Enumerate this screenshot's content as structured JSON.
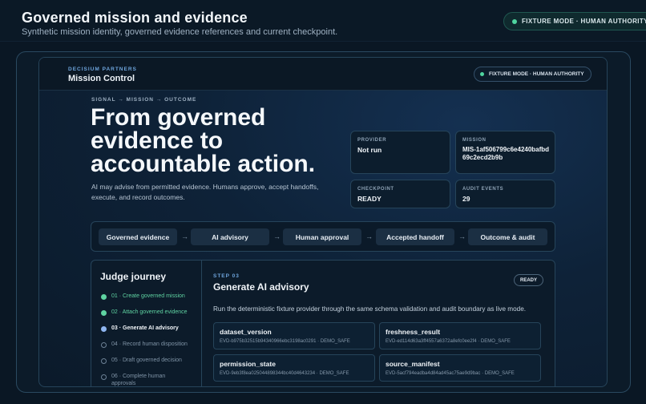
{
  "header": {
    "title": "Governed mission and evidence",
    "subtitle": "Synthetic mission identity, governed evidence references and current checkpoint.",
    "mode_pill": "FIXTURE MODE · HUMAN AUTHORITY"
  },
  "panel": {
    "brand": "DECISIUM PARTNERS",
    "title": "Mission Control",
    "mode_pill": "FIXTURE MODE · HUMAN AUTHORITY",
    "kicker": "SIGNAL → MISSION → OUTCOME",
    "hero": "From governed evidence to accountable action.",
    "hero_sub": "AI may advise from permitted evidence. Humans approve, accept handoffs, execute, and record outcomes."
  },
  "stats": {
    "provider": {
      "label": "PROVIDER",
      "value": "Not run"
    },
    "mission": {
      "label": "MISSION",
      "value": "MIS-1af506799c6e4240bafbd69c2ecd2b9b"
    },
    "checkpoint": {
      "label": "CHECKPOINT",
      "value": "READY"
    },
    "audit": {
      "label": "AUDIT EVENTS",
      "value": "29"
    }
  },
  "flow": {
    "steps": [
      "Governed evidence",
      "AI advisory",
      "Human approval",
      "Accepted handoff",
      "Outcome & audit"
    ],
    "arrow": "→"
  },
  "journey": {
    "title": "Judge journey",
    "items": [
      {
        "label": "01 · Create governed mission",
        "state": "done"
      },
      {
        "label": "02 · Attach governed evidence",
        "state": "done"
      },
      {
        "label": "03 · Generate AI advisory",
        "state": "active"
      },
      {
        "label": "04 · Record human disposition",
        "state": "pending"
      },
      {
        "label": "05 · Draft governed decision",
        "state": "pending"
      },
      {
        "label": "06 · Complete human approvals",
        "state": "pending"
      }
    ]
  },
  "step": {
    "kicker": "STEP 03",
    "title": "Generate AI advisory",
    "badge": "READY",
    "description": "Run the deterministic fixture provider through the same schema validation and audit boundary as live mode.",
    "cards": [
      {
        "title": "dataset_version",
        "sub": "EVD-b975b32515b94340966ebc3198ac0291 · DEMO_SAFE"
      },
      {
        "title": "freshness_result",
        "sub": "EVD-ed114d63a3ff4557a6372a8efc0ee2f4 · DEMO_SAFE"
      },
      {
        "title": "permission_state",
        "sub": "EVD-9eb3f8ea025044898344bc40d4643234 · DEMO_SAFE"
      },
      {
        "title": "source_manifest",
        "sub": "EVD-5acf794eadba4d84ad45ac75ae9d9bac · DEMO_SAFE"
      }
    ]
  }
}
